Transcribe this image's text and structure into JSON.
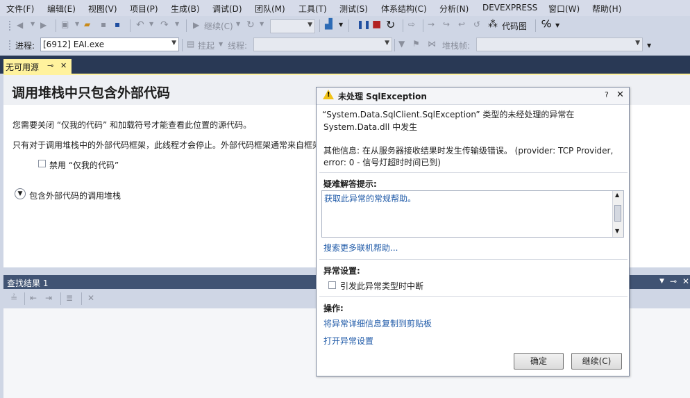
{
  "menu": [
    "文件(F)",
    "编辑(E)",
    "视图(V)",
    "项目(P)",
    "生成(B)",
    "调试(D)",
    "团队(M)",
    "工具(T)",
    "测试(S)",
    "体系结构(C)",
    "分析(N)",
    "DEVEXPRESS",
    "窗口(W)",
    "帮助(H)"
  ],
  "toolbar1": {
    "continue_label": "继续(C)",
    "codemap_label": "代码图"
  },
  "toolbar2": {
    "process_label": "进程:",
    "process_value": "[6912] EAI.exe",
    "suspend_label": "挂起",
    "thread_label": "线程:",
    "stackframe_label": "堆栈帧:"
  },
  "doc_tab": {
    "title": "无可用源",
    "pin": "⊸",
    "close": "✕"
  },
  "content": {
    "heading": "调用堆栈中只包含外部代码",
    "line1": "您需要关闭 “仅我的代码” 和加载符号才能查看此位置的源代码。",
    "line2": "只有对于调用堆栈中的外部代码框架，此线程才会停止。外部代码框架通常来自框架",
    "checkbox_label": "禁用 “仅我的代码”",
    "expander_label": "包含外部代码的调用堆栈"
  },
  "find_panel": {
    "title": "查找结果 1"
  },
  "dialog": {
    "title": "未处理 SqlException",
    "help": "?",
    "close": "✕",
    "msg1": " “System.Data.SqlClient.SqlException” 类型的未经处理的异常在",
    "msg2": "System.Data.dll 中发生",
    "info1": "其他信息: 在从服务器接收结果时发生传输级错误。 (provider: TCP Provider,",
    "info2": "error: 0 - 信号灯超时时间已到)",
    "tips_label": "疑难解答提示:",
    "tips_link": "获取此异常的常规帮助。",
    "search_link": "搜索更多联机帮助...",
    "settings_label": "异常设置:",
    "break_checkbox": "引发此异常类型时中断",
    "actions_label": "操作:",
    "copy_link": "将异常详细信息复制到剪贴板",
    "open_link": "打开异常设置",
    "ok": "确定",
    "continue": "继续(C)"
  }
}
